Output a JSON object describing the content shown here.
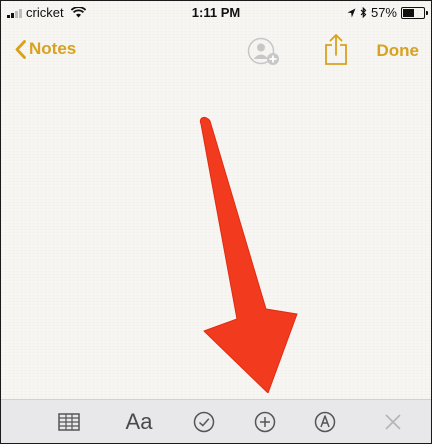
{
  "status_bar": {
    "carrier": "cricket",
    "time": "1:11 PM",
    "battery_percent": "57%",
    "battery_level": 0.57
  },
  "nav": {
    "back_label": "Notes",
    "done_label": "Done",
    "accent_color": "#d8a21f"
  },
  "toolbar": {
    "format_label": "Aa",
    "items": [
      "table-icon",
      "format-text-button",
      "checklist-icon",
      "add-icon",
      "markup-icon",
      "close-icon"
    ]
  },
  "annotation": {
    "arrow_color": "#f23b1e"
  }
}
